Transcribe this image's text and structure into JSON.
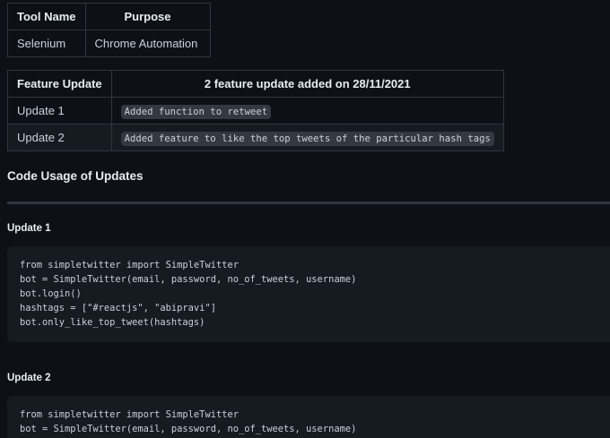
{
  "tools_table": {
    "headers": [
      "Tool Name",
      "Purpose"
    ],
    "rows": [
      [
        "Selenium",
        "Chrome Automation"
      ]
    ]
  },
  "features_table": {
    "headers": [
      "Feature Update",
      "2 feature update added on 28/11/2021"
    ],
    "rows": [
      [
        "Update 1",
        "Added function to retweet"
      ],
      [
        "Update 2",
        "Added feature to like the top tweets of the particular hash tags"
      ]
    ]
  },
  "section_heading": "Code Usage of Updates",
  "updates": [
    {
      "title": "Update 1",
      "code": [
        "from simpletwitter import SimpleTwitter",
        "bot = SimpleTwitter(email, password, no_of_tweets, username)",
        "bot.login()",
        "hashtags = [\"#reactjs\", \"abipravi\"]",
        "bot.only_like_top_tweet(hashtags)"
      ]
    },
    {
      "title": "Update 2",
      "code": [
        "from simpletwitter import SimpleTwitter",
        "bot = SimpleTwitter(email, password, no_of_tweets, username)"
      ]
    }
  ]
}
